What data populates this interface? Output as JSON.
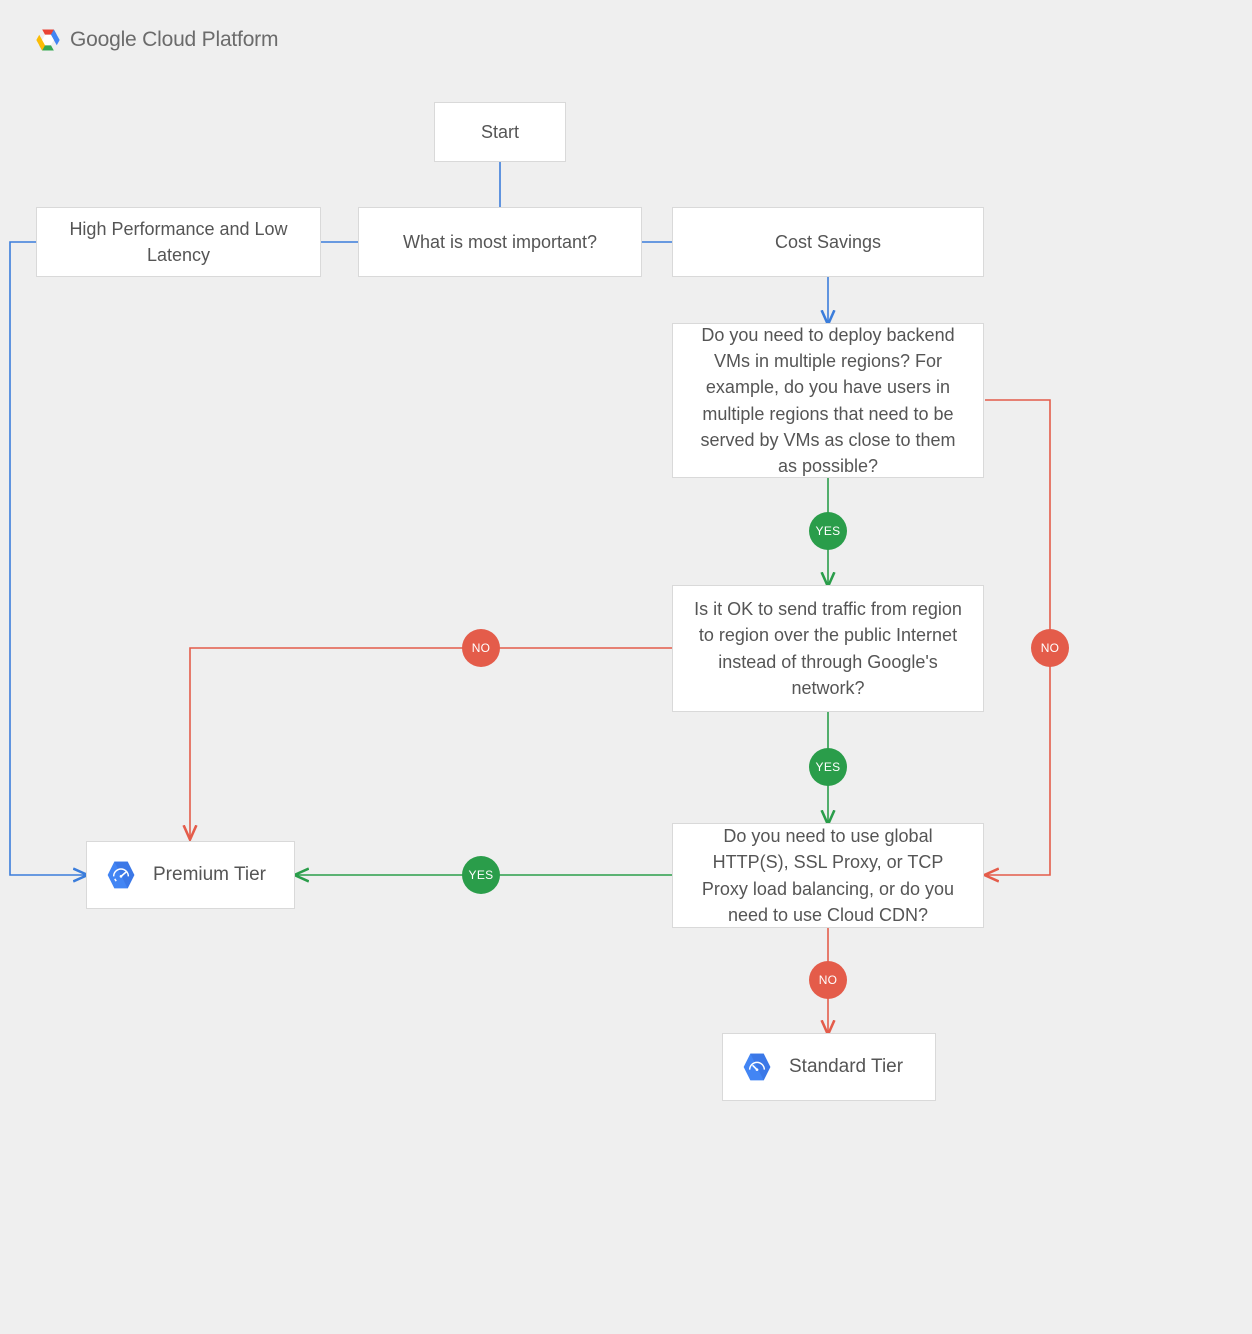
{
  "header": {
    "brand_google": "Google",
    "brand_rest": " Cloud Platform"
  },
  "nodes": {
    "start": "Start",
    "high_perf": "High Performance and Low Latency",
    "question_root": "What is most important?",
    "cost_savings": "Cost Savings",
    "deploy_regions": "Do you need to deploy backend VMs in multiple regions? For example, do you have users in multiple regions that need to be served by VMs as close to them as possible?",
    "public_internet": "Is it OK to send traffic from region to region over the public Internet instead of through Google's network?",
    "load_balancing": "Do you need to use global HTTP(S), SSL Proxy, or TCP Proxy load balancing, or do you need to use Cloud CDN?",
    "premium_tier": "Premium Tier",
    "standard_tier": "Standard Tier"
  },
  "badges": {
    "yes": "YES",
    "no": "NO"
  },
  "colors": {
    "blue": "#3b7ddb",
    "green": "#2a9d4a",
    "red": "#e45c4a"
  }
}
